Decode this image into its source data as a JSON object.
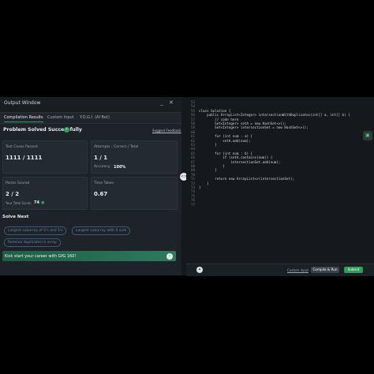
{
  "window": {
    "title": "Output Window"
  },
  "tabs": [
    "Compilation Results",
    "Custom Input",
    "Y.O.G.I. (AI Bot)"
  ],
  "result": {
    "status": "Problem Solved Successfully",
    "feedback_link": "Suggest Feedback"
  },
  "cards": {
    "tests": {
      "label": "Test Cases Passed",
      "value": "1111 / 1111"
    },
    "attempts": {
      "label": "Attempts : Correct / Total",
      "value": "1 / 1",
      "accuracy_label": "Accuracy :",
      "accuracy": "100%"
    },
    "points": {
      "label": "Points Scored",
      "value": "2 / 2",
      "total_label": "Your Total Score:",
      "total": "74"
    },
    "time": {
      "label": "Time Taken",
      "value": "0.67"
    }
  },
  "solve_next": {
    "title": "Solve Next",
    "items": [
      "Largest subarray of 0's and 1's",
      "Largest subarray with 0 sum",
      "Remove duplicates in array"
    ]
  },
  "banner": {
    "text": "Kick start your career with GfG 160!"
  },
  "editor": {
    "lines": [
      {
        "n": "53",
        "code": ""
      },
      {
        "n": "54",
        "code": ""
      },
      {
        "n": "55",
        "code": "class Solution {"
      },
      {
        "n": "56",
        "code": "    public ArrayList<Integer> intersectionWithDuplicates(int[] a, int[] b) {"
      },
      {
        "n": "57",
        "code": "        // code here"
      },
      {
        "n": "58",
        "code": "        Set<Integer> setA = new HashSet<>();"
      },
      {
        "n": "59",
        "code": "        Set<Integer> intersectionSet = new HashSet<>();"
      },
      {
        "n": "60",
        "code": ""
      },
      {
        "n": "61",
        "code": "        for (int num : a) {"
      },
      {
        "n": "62",
        "code": "            setA.add(num);"
      },
      {
        "n": "63",
        "code": "        }"
      },
      {
        "n": "64",
        "code": ""
      },
      {
        "n": "65",
        "code": "        for (int num : b) {"
      },
      {
        "n": "66",
        "code": "            if (setA.contains(num)) {"
      },
      {
        "n": "67",
        "code": "                intersectionSet.add(num);"
      },
      {
        "n": "68",
        "code": "            }"
      },
      {
        "n": "69",
        "code": "        }"
      },
      {
        "n": "70",
        "code": ""
      },
      {
        "n": "71",
        "code": "        return new ArrayList<>(intersectionSet);"
      },
      {
        "n": "72",
        "code": "    }"
      },
      {
        "n": "73",
        "code": "}"
      },
      {
        "n": "74",
        "code": ""
      },
      {
        "n": "75",
        "code": ""
      },
      {
        "n": "76",
        "code": ""
      },
      {
        "n": "77",
        "code": ""
      }
    ],
    "custom_input": "Custom Input",
    "compile_run": "Compile & Run",
    "submit": "Submit"
  },
  "colors": {
    "accent": "#2f9e5a",
    "link": "#5f87ad"
  }
}
